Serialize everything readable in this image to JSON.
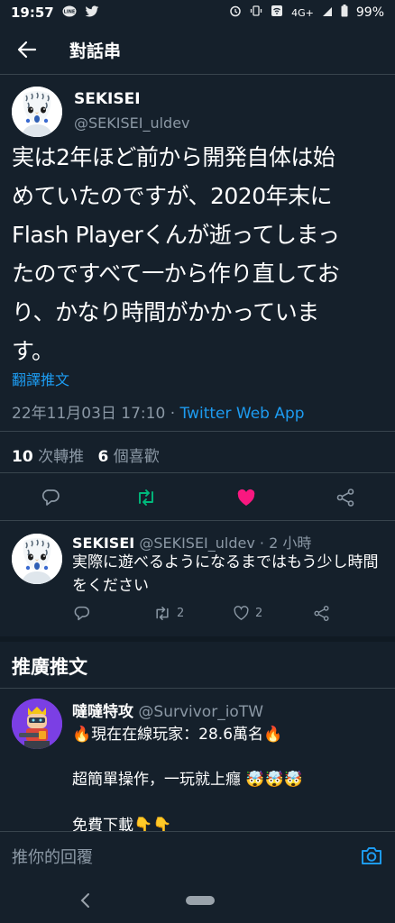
{
  "status_bar": {
    "time": "19:57",
    "network": "4G+",
    "battery": "99%"
  },
  "header": {
    "title": "對話串"
  },
  "tweet": {
    "author_name": "SEKISEI",
    "author_handle": "@SEKISEI_uldev",
    "text": "実は2年ほど前から開発自体は始\nめていたのですが、2020年末に\nFlash Playerくんが逝ってしまっ\nたのですべて一から作り直してお\nり、かなり時間がかかっていま\nす。",
    "translate_label": "翻譯推文",
    "timestamp": "22年11月03日 17:10",
    "separator": " · ",
    "source": "Twitter Web App",
    "retweet_count": "10",
    "retweet_label": " 次轉推",
    "like_count": "6",
    "like_label": " 個喜歡"
  },
  "reply": {
    "author_name": "SEKISEI",
    "author_handle": "@SEKISEI_uldev",
    "time": " · 2 小時",
    "text": "実際に遊べるようになるまではもう少し時間をください",
    "retweet_count": "2",
    "like_count": "2"
  },
  "promoted_section": {
    "title": "推廣推文",
    "author_name": "噠噠特攻",
    "author_handle": "@Survivor_ioTW",
    "line1": "🔥現在在線玩家：28.6萬名🔥",
    "line2": "超簡單操作，一玩就上癮 🤯🤯🤯",
    "line3": "免費下載👇👇"
  },
  "compose": {
    "placeholder": "推你的回覆"
  },
  "colors": {
    "background": "#15202b",
    "accent": "#1d9bf0",
    "like": "#f91880",
    "retweet": "#00ba7c",
    "muted": "#8b98a5",
    "divider": "#38444d"
  }
}
